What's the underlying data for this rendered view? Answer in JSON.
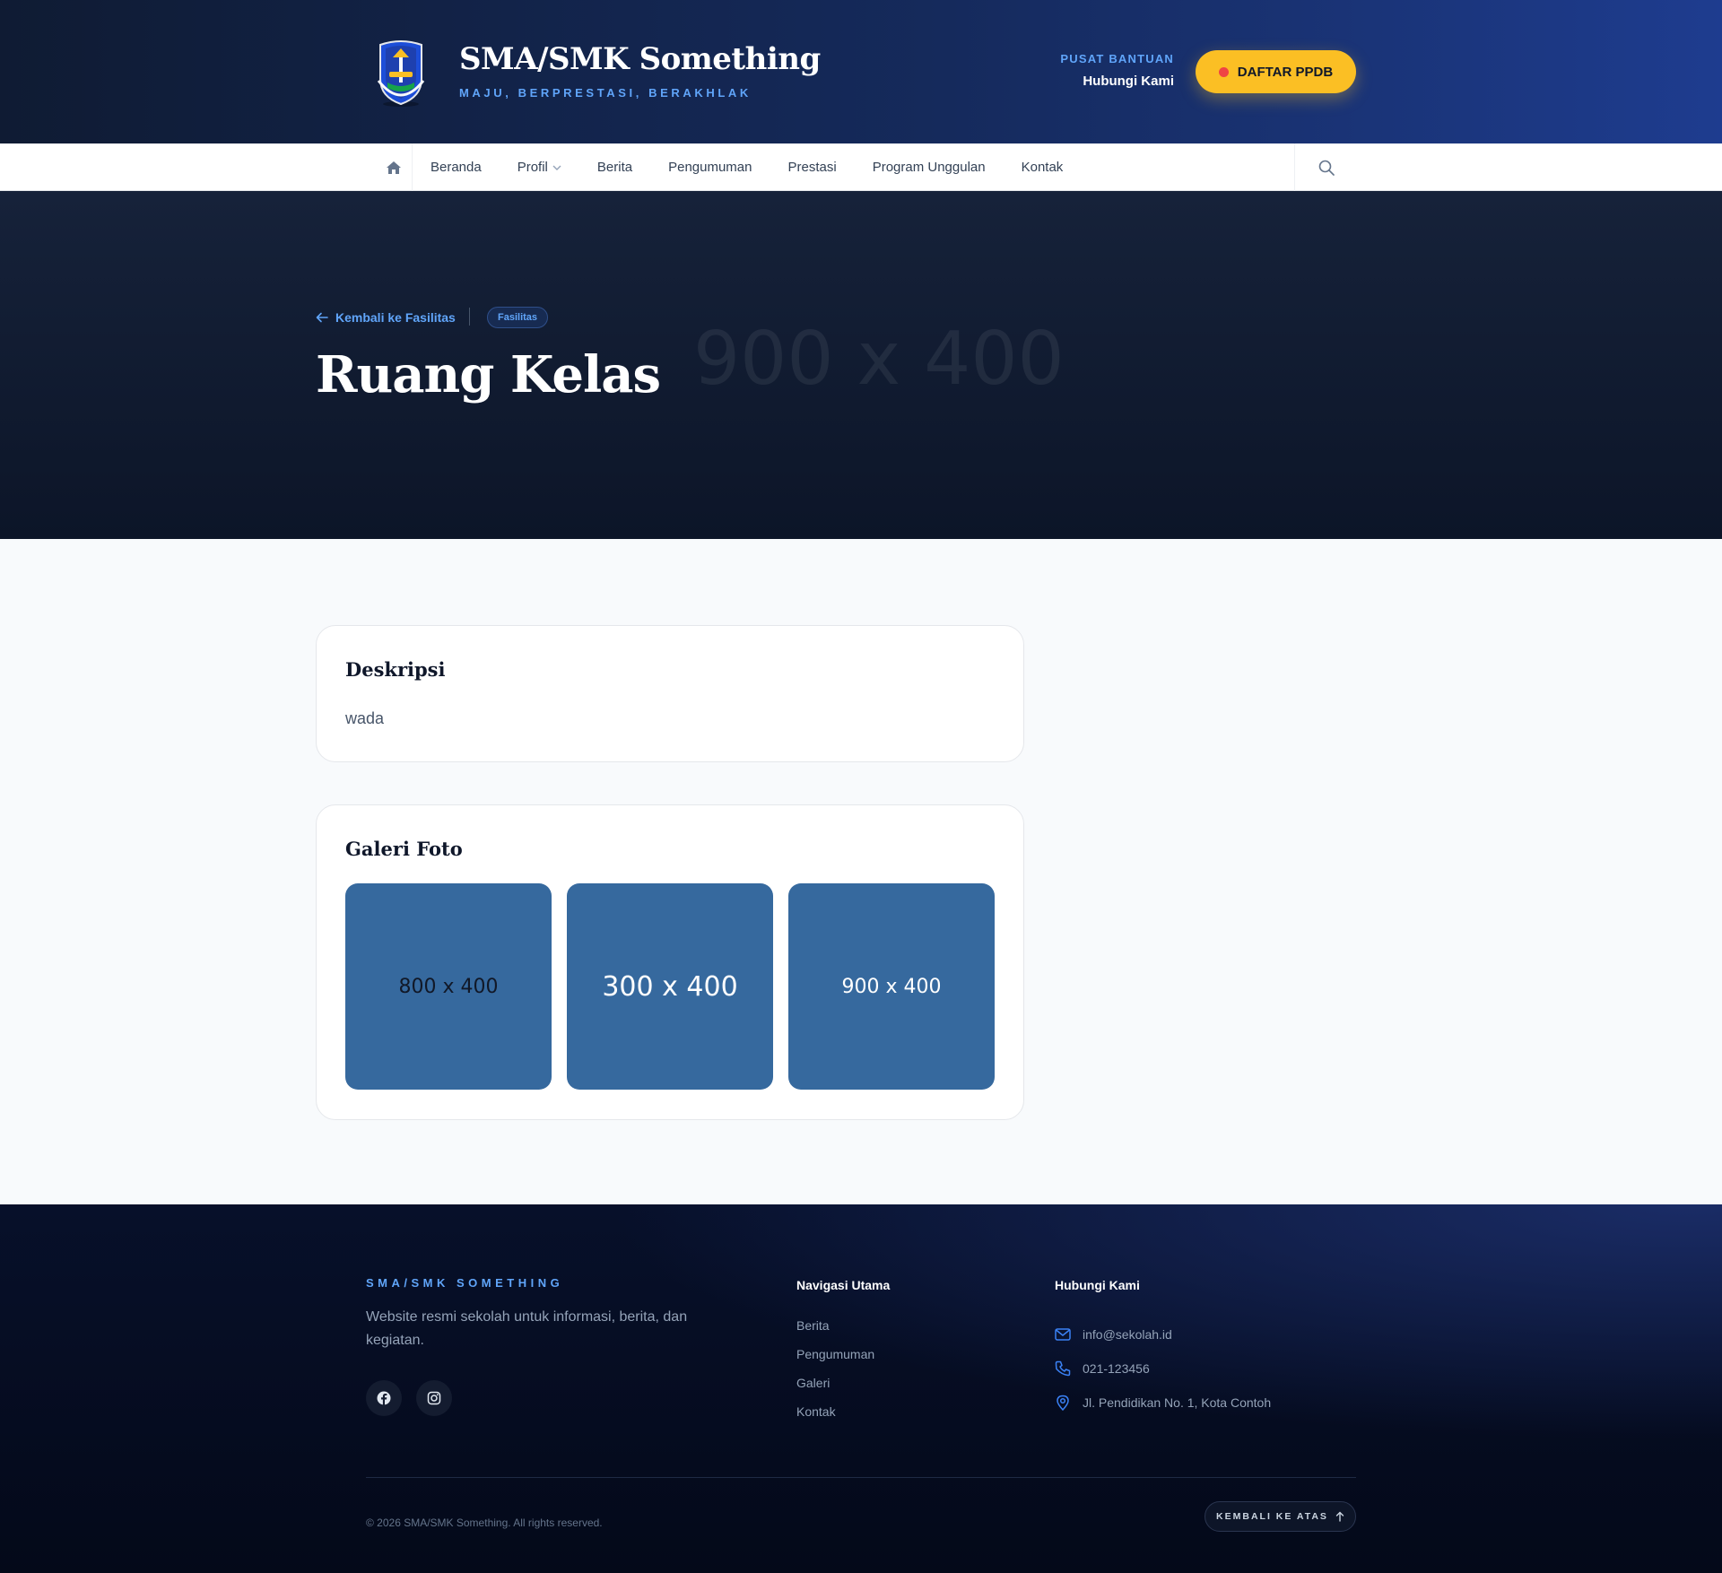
{
  "header": {
    "site_title": "SMA/SMK Something",
    "tagline": "MAJU, BERPRESTASI, BERAKHLAK",
    "help_label": "PUSAT BANTUAN",
    "help_contact": "Hubungi Kami",
    "cta_label": "DAFTAR PPDB"
  },
  "nav": {
    "items": [
      {
        "label": "Beranda"
      },
      {
        "label": "Profil"
      },
      {
        "label": "Berita"
      },
      {
        "label": "Pengumuman"
      },
      {
        "label": "Prestasi"
      },
      {
        "label": "Program Unggulan"
      },
      {
        "label": "Kontak"
      }
    ]
  },
  "hero": {
    "back_link": "Kembali ke Fasilitas",
    "badge": "Fasilitas",
    "title": "Ruang Kelas",
    "image_placeholder": "900 x 400"
  },
  "description": {
    "title": "Deskripsi",
    "text": "wada"
  },
  "gallery": {
    "title": "Galeri Foto",
    "photos": [
      {
        "label": "800 x 400"
      },
      {
        "label": "300 x 400"
      },
      {
        "label": "900 x 400"
      }
    ]
  },
  "footer": {
    "brand": "SMA/SMK SOMETHING",
    "description": "Website resmi sekolah untuk informasi, berita, dan kegiatan.",
    "nav_title": "Navigasi Utama",
    "nav_links": [
      {
        "label": "Berita"
      },
      {
        "label": "Pengumuman"
      },
      {
        "label": "Galeri"
      },
      {
        "label": "Kontak"
      }
    ],
    "contact_title": "Hubungi Kami",
    "email": "info@sekolah.id",
    "phone": "021-123456",
    "address": "Jl. Pendidikan No. 1, Kota Contoh",
    "copyright": "© 2026 SMA/SMK Something. All rights reserved.",
    "back_to_top": "KEMBALI KE ATAS"
  },
  "colors": {
    "accent": "#60a5fa",
    "cta": "#fbbf24",
    "photo_bg": "#36699e",
    "hero_bg": "#0c1528"
  }
}
